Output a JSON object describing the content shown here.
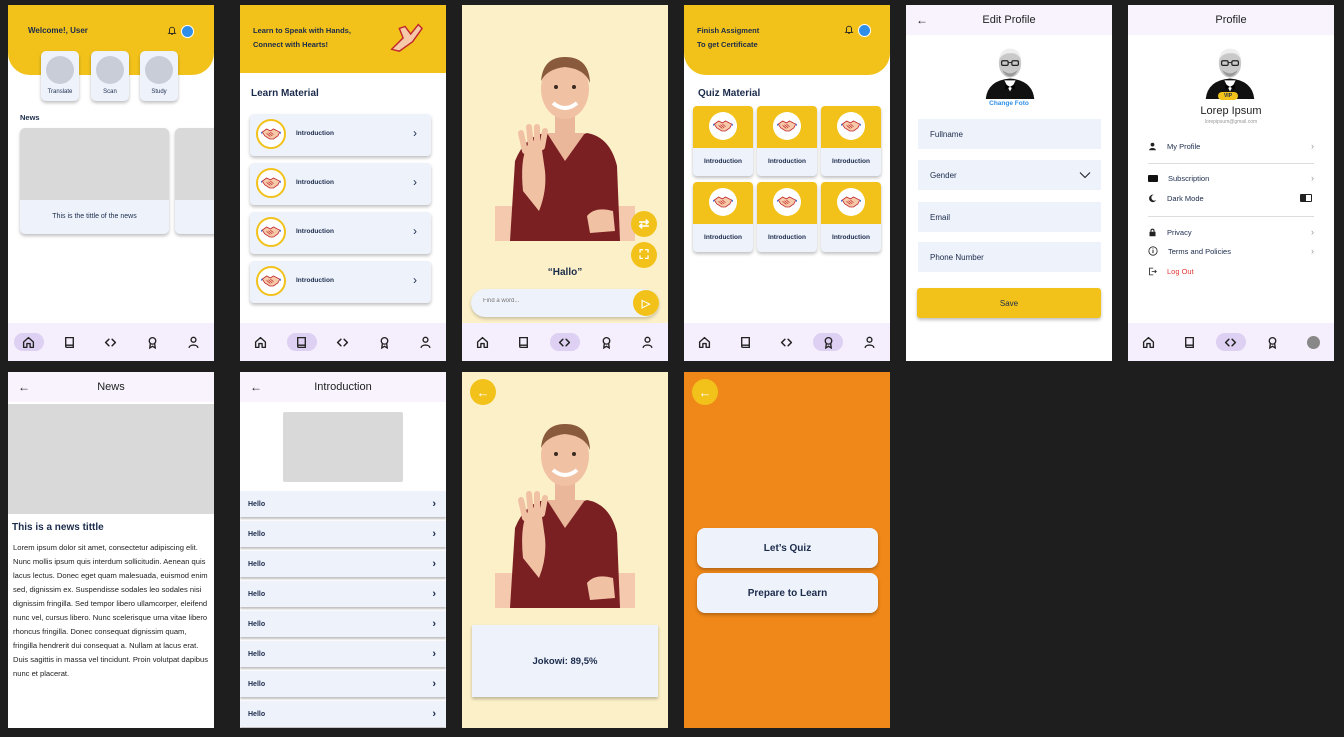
{
  "colors": {
    "accent": "#f2c21b",
    "navy": "#1b2b4b",
    "card": "#eef2fb",
    "orange": "#ef8719",
    "cream": "#fcf0c8",
    "danger": "#e53935",
    "link": "#2f8fe8"
  },
  "nav_icons": [
    "home-icon",
    "book-icon",
    "code-icon",
    "award-icon",
    "user-icon"
  ],
  "home": {
    "welcome": "Welcome!, User",
    "features": [
      {
        "label": "Translate",
        "icon": "translate-icon"
      },
      {
        "label": "Scan",
        "icon": "scan-icon"
      },
      {
        "label": "Study",
        "icon": "graduation-cap-icon"
      }
    ],
    "news_heading": "News",
    "news_card_title": "This is the tittle of the news"
  },
  "learn": {
    "banner": [
      "Learn to Speak with Hands,",
      "Connect with Hearts!"
    ],
    "section_title": "Learn Material",
    "items": [
      "Introduction",
      "Introduction",
      "Introduction",
      "Introduction"
    ]
  },
  "translate": {
    "word": "“Hallo”",
    "search_placeholder": "Find a word..."
  },
  "quiz": {
    "banner": [
      "Finish Assigment",
      "To get Certificate"
    ],
    "section_title": "Quiz Material",
    "items": [
      "Introduction",
      "Introduction",
      "Introduction",
      "Introduction",
      "Introduction",
      "Introduction"
    ]
  },
  "edit_profile": {
    "title": "Edit Profile",
    "change_photo": "Change Foto",
    "fields": [
      "Fullname",
      "Gender",
      "Email",
      "Phone Number"
    ],
    "save": "Save"
  },
  "profile": {
    "title": "Profile",
    "badge": "VIP",
    "name": "Lorep Ipsum",
    "email": "lorepipsum@gmail.com",
    "menu": [
      "My Profile",
      "Subscription",
      "Dark Mode",
      "Privacy",
      "Terms and Policies",
      "Log Out"
    ]
  },
  "news_detail": {
    "title": "News",
    "headline": "This is a news tittle",
    "body": "Lorem ipsum dolor sit amet, consectetur adipiscing elit. Nunc mollis ipsum quis interdum sollicitudin. Aenean quis lacus lectus. Donec eget quam malesuada, euismod enim sed, dignissim ex. Suspendisse sodales leo sodales nisi dignissim fringilla. Sed tempor libero ullamcorper, eleifend nunc vel, cursus libero. Nunc scelerisque urna vitae libero rhoncus fringilla. Donec consequat dignissim quam, fringilla hendrerit dui consequat a. Nullam at lacus erat. Duis sagittis in massa vel tincidunt. Proin volutpat dapibus nunc et placerat."
  },
  "intro_detail": {
    "title": "Introduction",
    "items": [
      "Hello",
      "Hello",
      "Hello",
      "Hello",
      "Hello",
      "Hello",
      "Hello",
      "Hello"
    ]
  },
  "result": {
    "score_text": "Jokowi: 89,5%"
  },
  "choice": {
    "quiz_button": "Let’s Quiz",
    "learn_button": "Prepare to Learn"
  }
}
